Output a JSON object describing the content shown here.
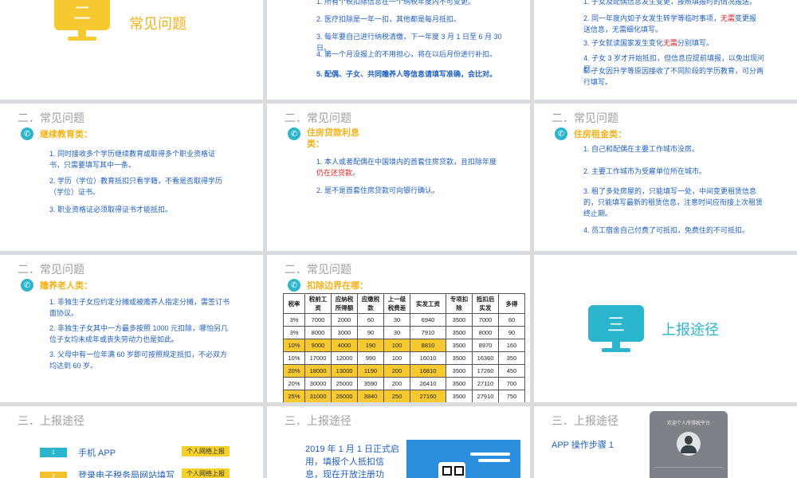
{
  "s1": {
    "num": "二",
    "title": "常见问题"
  },
  "s2": {
    "p1": "1. 所有个税扣除信息在一个纳税年度内不可变更。",
    "p2": "2. 医疗扣除是一年一扣，其他都是每月抵扣。",
    "p3": "3. 每年要自己进行纳税清缴，下一年度 3 月 1 日至 6 月 30 日。",
    "p4": "4. 第一个月没报上的不用担心，将在以后月份进行补扣。",
    "p5": "5. 配偶、子女、共同赡养人等信息请填写准确，会比对。"
  },
  "s3": {
    "p1": "1. 子女及配偶信息发生变更，按照填报时的情况报送。",
    "p2a": "2. 同一年度内如子女发生转学等临时事项，",
    "p2b": "无需",
    "p2c": "变更报送信息，无需细化填写。",
    "p3a": "3. 子女就读国家发生变化",
    "p3b": "无需",
    "p3c": "分别填写。",
    "p4": "4. 子女 3 岁才开始抵扣，但信息应提前填报，以免出现问题。",
    "p5": "5. 子女因升学等原因接收了不同阶段的学历教育，可分两行填写。"
  },
  "s4": {
    "section": "二．常见问题",
    "badge": "✆",
    "heading": "继续教育类：",
    "p1": "1. 同时接收多个学历继续教育或取得多个职业资格证书，只需要填写其中一条。",
    "p2": "2. 学历（学位）教育抵扣只看学籍，不看是否取得学历（学位）证书。",
    "p3": "3. 职业资格证必须取得证书才能抵扣。"
  },
  "s5": {
    "section": "二．常见问题",
    "badge": "✆",
    "heading": "住房贷款利息类：",
    "p1a": "1. 本人或者配偶在中国境内的首套住房贷款，且扣除年度",
    "p1b": "仍在还贷款",
    "p1c": "。",
    "p2": "2. 是不是首套住房贷款可向银行确认。"
  },
  "s6": {
    "section": "二．常见问题",
    "badge": "✆",
    "heading": "住房租金类：",
    "p1": "1. 自己和配偶在主要工作城市没房。",
    "p2": "2. 主要工作城市为受雇单位所在城市。",
    "p3": "3. 租了多处房屋的，只能填写一处，中间变更租赁信息的，只能填写最新的租赁信息，注意时间应衔接上次租赁终止期。",
    "p4": "4. 员工宿舍自己付费了可抵扣，免费住的不可抵扣。"
  },
  "s7": {
    "section": "二．常见问题",
    "badge": "✆",
    "heading": "赡养老人类：",
    "p1": "1. 非独生子女应约定分摊或被赡养人指定分摊，需签订书面协议。",
    "p2": "2. 非独生子女其中一方最多按照 1000 元扣除，哪怕另几位子女均未成年或丧失劳动力也是如此。",
    "p3": "3. 父母中有一位年满 60 岁即可按照规定抵扣，不必双方均达到 60 岁。"
  },
  "s8": {
    "section": "二．常见问题",
    "badge": "✆",
    "heading": "扣除边界在哪：",
    "headers": [
      "税率",
      "税前工资",
      "应纳税所得额",
      "应缴税款",
      "上一级税费差",
      "实发工资",
      "专项扣除",
      "抵扣后实发",
      "多得"
    ],
    "rows": [
      [
        "3%",
        "7000",
        "2000",
        "60",
        "30",
        "6940",
        "3500",
        "7000",
        "60"
      ],
      [
        "3%",
        "8000",
        "3000",
        "90",
        "30",
        "7910",
        "3500",
        "8000",
        "90"
      ],
      [
        "10%",
        "9000",
        "4000",
        "190",
        "100",
        "8810",
        "3500",
        "8970",
        "160"
      ],
      [
        "10%",
        "17000",
        "12000",
        "990",
        "100",
        "16010",
        "3500",
        "16360",
        "350"
      ],
      [
        "20%",
        "18000",
        "13000",
        "1190",
        "200",
        "16810",
        "3500",
        "17260",
        "450"
      ],
      [
        "20%",
        "30000",
        "25000",
        "3590",
        "200",
        "26410",
        "3500",
        "27110",
        "700"
      ],
      [
        "25%",
        "31000",
        "26000",
        "3840",
        "250",
        "27160",
        "3500",
        "27910",
        "750"
      ]
    ],
    "highlight_rows": [
      2,
      4,
      6
    ],
    "highlight_color": "#f7c931"
  },
  "s9": {
    "num": "三",
    "title": "上报途径"
  },
  "s10": {
    "section": "三．上报途径",
    "items": [
      {
        "num": "1",
        "label": "手机 APP",
        "tag": "个人网络上报"
      },
      {
        "num": "2",
        "label": "登录电子税务局网站填写",
        "tag": "个人网络上报"
      }
    ]
  },
  "s11": {
    "section": "三．上报途径",
    "text": "2019 年 1 月 1 日正式启用，填报个人抵扣信息，现在开放注册功能。"
  },
  "s12": {
    "section": "三．上报途径",
    "step": "APP 操作步骤 1",
    "phone_title": "欢迎个人所得税平台"
  },
  "colors": {
    "accent_teal": "#2bb5cc",
    "accent_yellow": "#f7c931",
    "text_blue": "#1f5fbf",
    "warn_red": "#e02020"
  }
}
